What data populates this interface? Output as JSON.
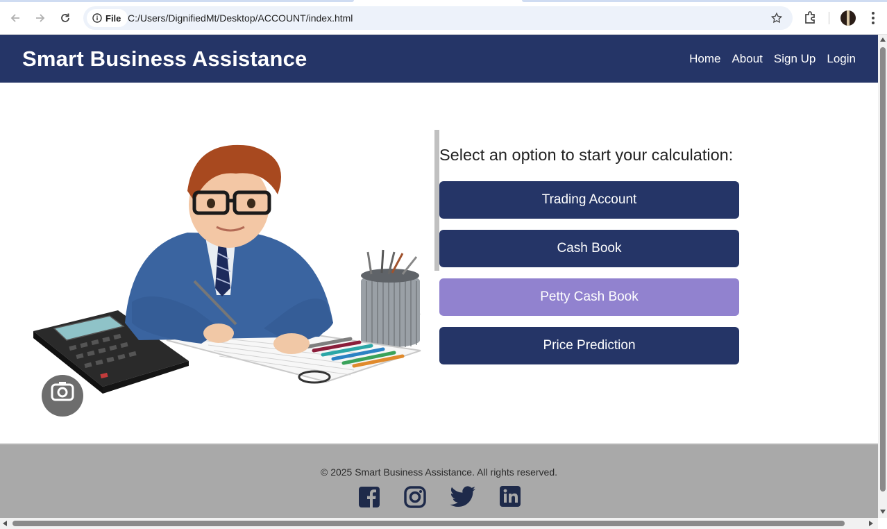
{
  "browser": {
    "file_chip": "File",
    "url": "C:/Users/DignifiedMt/Desktop/ACCOUNT/index.html",
    "icons": [
      "back-icon",
      "forward-icon",
      "reload-icon",
      "info-icon",
      "star-icon",
      "extensions-icon",
      "profile-avatar",
      "menu-icon"
    ]
  },
  "header": {
    "brand": "Smart Business Assistance",
    "nav": [
      "Home",
      "About",
      "Sign Up",
      "Login"
    ]
  },
  "main": {
    "prompt": "Select an option to start your calculation:",
    "options": [
      "Trading Account",
      "Cash Book",
      "Petty Cash Book",
      "Price Prediction"
    ],
    "active_option": "Petty Cash Book",
    "hero_image": "accountant-illustration"
  },
  "footer": {
    "copyright": "© 2025 Smart Business Assistance. All rights reserved.",
    "social": [
      "facebook-icon",
      "instagram-icon",
      "twitter-icon",
      "linkedin-icon"
    ]
  },
  "colors": {
    "primary": "#253567",
    "active_button": "#9182cf",
    "footer_bg": "#a9a9a9"
  }
}
